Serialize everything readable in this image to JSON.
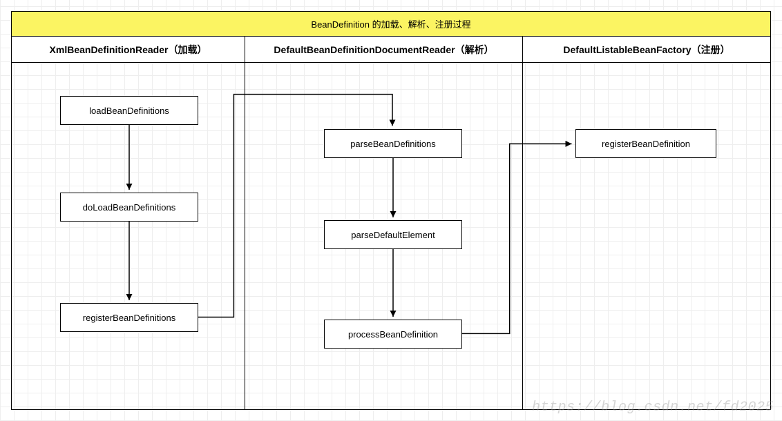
{
  "title": "BeanDefinition 的加载、解析、注册过程",
  "columns": {
    "col1": {
      "header": "XmlBeanDefinitionReader（加载）"
    },
    "col2": {
      "header": "DefaultBeanDefinitionDocumentReader（解析）"
    },
    "col3": {
      "header": "DefaultListableBeanFactory（注册）"
    }
  },
  "nodes": {
    "load": "loadBeanDefinitions",
    "doload": "doLoadBeanDefinitions",
    "regdefs": "registerBeanDefinitions",
    "parse": "parseBeanDefinitions",
    "parsedefault": "parseDefaultElement",
    "process": "processBeanDefinition",
    "regdef": "registerBeanDefinition"
  },
  "watermark": "https://blog.csdn.net/fd2025"
}
